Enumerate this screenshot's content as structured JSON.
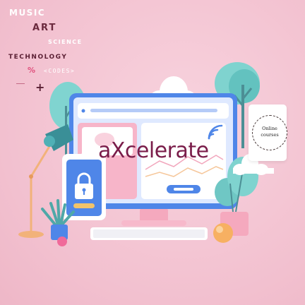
{
  "subject_words": {
    "music": "MUSIC",
    "art": "ART",
    "science": "SCIENCE",
    "technology": "TECHNOLOGY",
    "percent": "%",
    "codes": "<CODES>",
    "plus": "+"
  },
  "brand": {
    "name": "aXcelerate"
  },
  "badge": {
    "text": "Online courses"
  },
  "colors": {
    "background": "#f4c6d4",
    "monitor": "#4f86e8",
    "screen": "#e6efff",
    "brand_text": "#7a1d4a",
    "accent_pink": "#f6a8bf",
    "teal": "#4fc3c7",
    "lamp": "#3a8f97"
  },
  "icons": [
    "lock-icon",
    "wifi-icon",
    "lamp-icon",
    "plant-icon",
    "tree-icon",
    "cloud-icon",
    "keyboard-icon",
    "ball-icon"
  ]
}
